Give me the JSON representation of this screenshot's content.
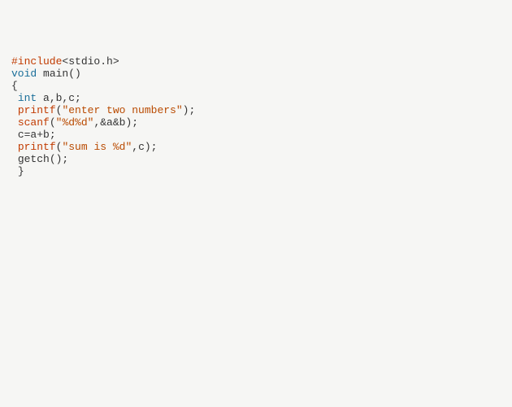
{
  "code": {
    "lines": [
      {
        "indent": "",
        "tokens": [
          {
            "cls": "tok-preproc",
            "text": "#include"
          },
          {
            "cls": "tok-default",
            "text": "<stdio.h>"
          }
        ]
      },
      {
        "indent": "",
        "tokens": [
          {
            "cls": "tok-keyword",
            "text": "void"
          },
          {
            "cls": "tok-default",
            "text": " main()"
          }
        ]
      },
      {
        "indent": "",
        "tokens": [
          {
            "cls": "tok-default",
            "text": "{"
          }
        ]
      },
      {
        "indent": " ",
        "tokens": [
          {
            "cls": "tok-keyword",
            "text": "int"
          },
          {
            "cls": "tok-default",
            "text": " a,b,c;"
          }
        ]
      },
      {
        "indent": " ",
        "tokens": [
          {
            "cls": "tok-preproc",
            "text": "printf"
          },
          {
            "cls": "tok-default",
            "text": "("
          },
          {
            "cls": "tok-string",
            "text": "\"enter two numbers\""
          },
          {
            "cls": "tok-default",
            "text": ");"
          }
        ]
      },
      {
        "indent": " ",
        "tokens": [
          {
            "cls": "tok-preproc",
            "text": "scanf"
          },
          {
            "cls": "tok-default",
            "text": "("
          },
          {
            "cls": "tok-string",
            "text": "\"%d%d\""
          },
          {
            "cls": "tok-default",
            "text": ",&a&b);"
          }
        ]
      },
      {
        "indent": " ",
        "tokens": [
          {
            "cls": "tok-default",
            "text": "c=a+b;"
          }
        ]
      },
      {
        "indent": " ",
        "tokens": [
          {
            "cls": "tok-preproc",
            "text": "printf"
          },
          {
            "cls": "tok-default",
            "text": "("
          },
          {
            "cls": "tok-string",
            "text": "\"sum is %d\""
          },
          {
            "cls": "tok-default",
            "text": ",c);"
          }
        ]
      },
      {
        "indent": " ",
        "tokens": [
          {
            "cls": "tok-default",
            "text": "getch();"
          }
        ]
      },
      {
        "indent": " ",
        "tokens": [
          {
            "cls": "tok-default",
            "text": "}"
          }
        ]
      }
    ]
  }
}
